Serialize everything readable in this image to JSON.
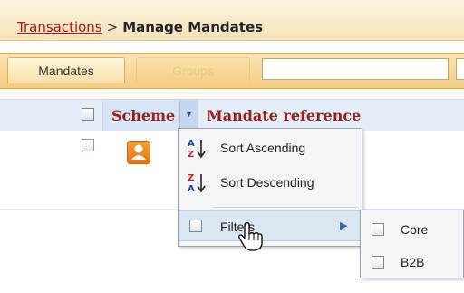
{
  "breadcrumb": {
    "link": "Transactions",
    "separator": ">",
    "current": "Manage Mandates"
  },
  "tabs": [
    {
      "label": "Mandates",
      "active": true
    },
    {
      "label": "Groups",
      "active": false
    }
  ],
  "search": {
    "value": "",
    "placeholder": ""
  },
  "grid": {
    "columns": [
      "Scheme",
      "Mandate reference"
    ],
    "row_icon": "person-icon"
  },
  "column_menu": {
    "items": [
      {
        "label": "Sort Ascending",
        "icon": "sort-ascending-icon"
      },
      {
        "label": "Sort Descending",
        "icon": "sort-descending-icon"
      },
      {
        "label": "Filters",
        "icon": "submenu-arrow-icon"
      }
    ]
  },
  "filter_submenu": {
    "items": [
      {
        "label": "Core",
        "checked": false
      },
      {
        "label": "B2B",
        "checked": false
      }
    ]
  },
  "colors": {
    "accent_orange": "#f4cd82",
    "header_text_red": "#9e1c1c",
    "link_red": "#b1121b",
    "grid_header_blue": "#e4edf8"
  }
}
